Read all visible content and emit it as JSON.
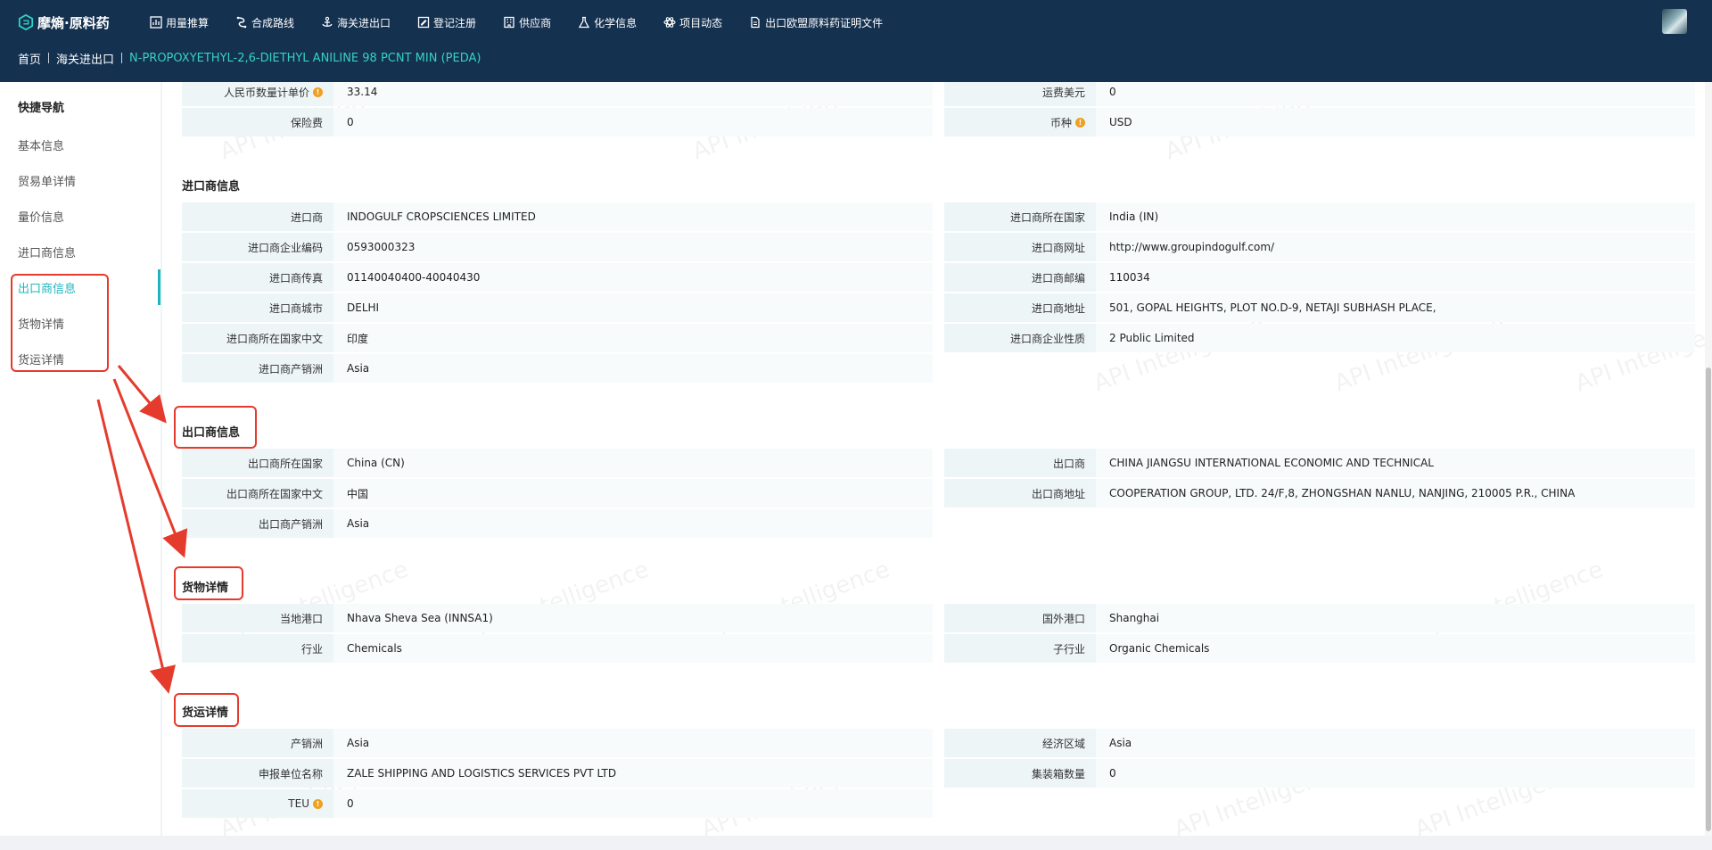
{
  "header": {
    "brand": "摩熵·原料药",
    "nav": [
      {
        "label": "用量推算",
        "icon": "chart-icon"
      },
      {
        "label": "合成路线",
        "icon": "route-icon"
      },
      {
        "label": "海关进出口",
        "icon": "anchor-icon"
      },
      {
        "label": "登记注册",
        "icon": "register-icon"
      },
      {
        "label": "供应商",
        "icon": "building-icon"
      },
      {
        "label": "化学信息",
        "icon": "flask-icon"
      },
      {
        "label": "项目动态",
        "icon": "atom-icon"
      },
      {
        "label": "出口欧盟原料药证明文件",
        "icon": "document-icon"
      }
    ]
  },
  "breadcrumb": {
    "home": "首页",
    "section": "海关进出口",
    "current": "N-PROPOXYETHYL-2,6-DIETHYL ANILINE 98 PCNT MIN (PEDA)"
  },
  "sidebar": {
    "title": "快捷导航",
    "items": [
      "基本信息",
      "贸易单详情",
      "量价信息",
      "进口商信息",
      "出口商信息",
      "货物详情",
      "货运详情"
    ],
    "active_index": 4
  },
  "price": {
    "rows": [
      {
        "l_label": "人民币数量计单价",
        "l_info": true,
        "l_value": "33.14",
        "r_label": "运费美元",
        "r_info": false,
        "r_value": "0"
      },
      {
        "l_label": "保险费",
        "l_info": false,
        "l_value": "0",
        "r_label": "币种",
        "r_info": true,
        "r_value": "USD"
      }
    ]
  },
  "importer": {
    "title": "进口商信息",
    "rows": [
      {
        "l_label": "进口商",
        "l_value": "INDOGULF CROPSCIENCES LIMITED",
        "r_label": "进口商所在国家",
        "r_value": "India (IN)"
      },
      {
        "l_label": "进口商企业编码",
        "l_value": "0593000323",
        "r_label": "进口商网址",
        "r_value": "http://www.groupindogulf.com/"
      },
      {
        "l_label": "进口商传真",
        "l_value": "01140040400-40040430",
        "r_label": "进口商邮编",
        "r_value": "110034"
      },
      {
        "l_label": "进口商城市",
        "l_value": "DELHI",
        "r_label": "进口商地址",
        "r_value": "501, GOPAL HEIGHTS, PLOT NO.D-9, NETAJI SUBHASH PLACE,"
      },
      {
        "l_label": "进口商所在国家中文",
        "l_value": "印度",
        "r_label": "进口商企业性质",
        "r_value": "2 Public Limited"
      },
      {
        "l_label": "进口商产销洲",
        "l_value": "Asia"
      }
    ]
  },
  "exporter": {
    "title": "出口商信息",
    "rows": [
      {
        "l_label": "出口商所在国家",
        "l_value": "China (CN)",
        "r_label": "出口商",
        "r_value": "CHINA JIANGSU INTERNATIONAL ECONOMIC AND TECHNICAL"
      },
      {
        "l_label": "出口商所在国家中文",
        "l_value": "中国",
        "r_label": "出口商地址",
        "r_value": "COOPERATION GROUP, LTD. 24/F,8, ZHONGSHAN NANLU, NANJING, 210005 P.R., CHINA"
      },
      {
        "l_label": "出口商产销洲",
        "l_value": "Asia"
      }
    ]
  },
  "goods": {
    "title": "货物详情",
    "rows": [
      {
        "l_label": "当地港口",
        "l_value": "Nhava Sheva Sea (INNSA1)",
        "r_label": "国外港口",
        "r_value": "Shanghai"
      },
      {
        "l_label": "行业",
        "l_value": "Chemicals",
        "r_label": "子行业",
        "r_value": "Organic Chemicals"
      }
    ]
  },
  "shipping": {
    "title": "货运详情",
    "rows": [
      {
        "l_label": "产销洲",
        "l_value": "Asia",
        "r_label": "经济区域",
        "r_value": "Asia"
      },
      {
        "l_label": "申报单位名称",
        "l_value": "ZALE SHIPPING AND LOGISTICS SERVICES PVT LTD",
        "r_label": "集装箱数量",
        "r_value": "0"
      },
      {
        "l_label": "TEU",
        "l_info": true,
        "l_value": "0"
      }
    ]
  },
  "watermark_text": "API Intelligence",
  "colors": {
    "header": "#143150",
    "accent": "#1fb5c0",
    "annotation": "#e53b2c",
    "info": "#f0a020"
  }
}
